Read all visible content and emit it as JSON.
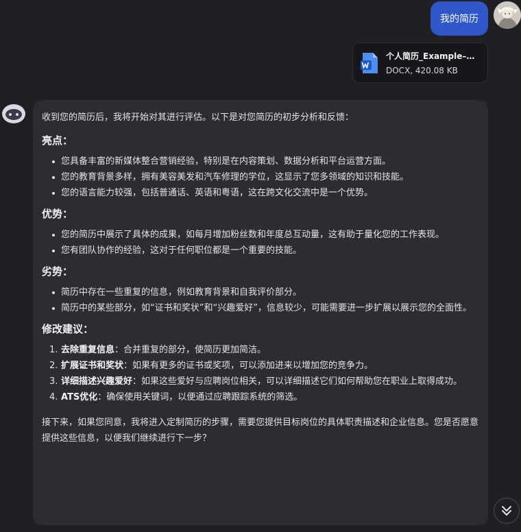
{
  "user": {
    "avatar_icon": "user-avatar-icon",
    "message": "我的简历",
    "attachment": {
      "icon": "word-doc-icon",
      "file_name": "个人简历_Example–修...",
      "file_info": "DOCX, 420.08 KB"
    }
  },
  "bot": {
    "avatar_icon": "bot-avatar-icon",
    "intro": "收到您的简历后，我将开始对其进行评估。以下是对您简历的初步分析和反馈：",
    "sections": [
      {
        "heading": "亮点：",
        "items": [
          "您具备丰富的新媒体整合营销经验，特别是在内容策划、数据分析和平台运营方面。",
          "您的教育背景多样，拥有美容美发和汽车修理的学位，这显示了您多领域的知识和技能。",
          "您的语言能力较强，包括普通话、英语和粤语，这在跨文化交流中是一个优势。"
        ]
      },
      {
        "heading": "优势：",
        "items": [
          "您的简历中展示了具体的成果，如每月增加粉丝数和年度总互动量，这有助于量化您的工作表现。",
          "您有团队协作的经验，这对于任何职位都是一个重要的技能。"
        ]
      },
      {
        "heading": "劣势：",
        "items": [
          "简历中存在一些重复的信息，例如教育背景和自我评价部分。",
          "简历中的某些部分，如“证书和奖状”和“兴趣爱好”，信息较少，可能需要进一步扩展以展示您的全面性。"
        ]
      }
    ],
    "suggestions": {
      "heading": "修改建议：",
      "items": [
        {
          "num": "1.",
          "label": "去除重复信息",
          "text": "：合并重复的部分，使简历更加简洁。"
        },
        {
          "num": "2.",
          "label": "扩展证书和奖状",
          "text": "：如果有更多的证书或奖项，可以添加进来以增加您的竞争力。"
        },
        {
          "num": "3.",
          "label": "详细描述兴趣爱好",
          "text": "：如果这些爱好与应聘岗位相关，可以详细描述它们如何帮助您在职业上取得成功。"
        },
        {
          "num": "4.",
          "label": "ATS优化",
          "text": "：确保使用关键词，以便通过应聘跟踪系统的筛选。"
        }
      ]
    },
    "outro": "接下来，如果您同意，我将进入定制简历的步骤，需要您提供目标岗位的具体职责描述和企业信息。您是否愿意提供这些信息，以便我们继续进行下一步？"
  },
  "controls": {
    "scroll_down_icon": "double-chevron-down-icon"
  },
  "colors": {
    "background": "#202024",
    "user_bubble": "#2f57c9",
    "bot_bubble": "#2c2c33",
    "word_blue": "#2b6bd6"
  }
}
